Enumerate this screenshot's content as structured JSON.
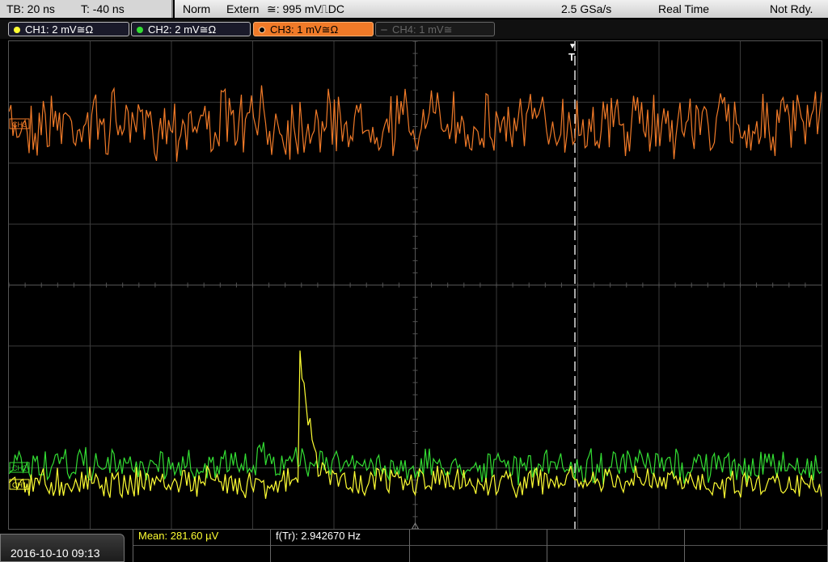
{
  "status": {
    "timebase": "TB: 20 ns",
    "trigger_time": "T: -40 ns",
    "mode": "Norm",
    "source": "Extern",
    "coupling_symbol": "≅: 995 mV",
    "slope": "⎍DC",
    "sample_rate": "2.5 GSa/s",
    "acquisition": "Real Time",
    "state": "Not Rdy."
  },
  "channels": [
    {
      "label": "CH1: 2 mV≅Ω",
      "color": "#ffff33",
      "active": true
    },
    {
      "label": "CH2: 2 mV≅Ω",
      "color": "#33dd33",
      "active": true
    },
    {
      "label": "CH3: 1 mV≅Ω",
      "color": "#f07a28",
      "active": true,
      "selected": true
    },
    {
      "label": "CH4: 1 mV≅",
      "color": "#666666",
      "active": false
    }
  ],
  "trace_markers": {
    "ch3": "CH3",
    "ch2": "CH2",
    "ch1": "CH1"
  },
  "trigger_marker": "T",
  "bottom": {
    "datetime": "2016-10-10 09:13",
    "measurement_mean": "Mean: 281.60 µV",
    "measurement_freq": "f(Tr): 2.942670 Hz"
  }
}
